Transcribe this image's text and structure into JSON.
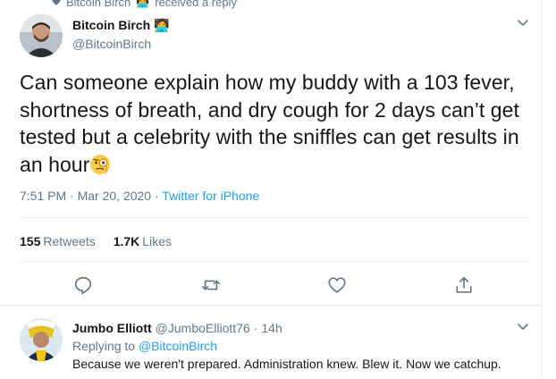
{
  "context": {
    "name": "Bitcoin Birch",
    "emoji": "🧑‍💻",
    "text": "received a reply"
  },
  "tweet": {
    "display_name": "Bitcoin Birch",
    "badge_emoji": "🧑‍💻",
    "handle": "@BitcoinBirch",
    "text": "Can someone explain how my buddy with a 103 fever, shortness of breath, and dry cough for 2 days can’t get tested but a celebrity with the sniffles can get results in an hour",
    "text_emoji": "face-with-monocle",
    "time": "7:51 PM",
    "sep": "·",
    "date": "Mar 20, 2020",
    "source": "Twitter for iPhone",
    "retweets_count": "155",
    "retweets_label": "Retweets",
    "likes_count": "1.7K",
    "likes_label": "Likes"
  },
  "actions": [
    {
      "icon": "reply-icon"
    },
    {
      "icon": "retweet-icon"
    },
    {
      "icon": "like-icon"
    },
    {
      "icon": "share-icon"
    }
  ],
  "reply": {
    "display_name": "Jumbo Elliott",
    "handle": "@JumboElliott76",
    "sep": "·",
    "time": "14h",
    "replying_to_label": "Replying to",
    "replying_to_handle": "@BitcoinBirch",
    "text": "Because we weren't prepared. Administration knew. Blew it. Now we catchup."
  },
  "colors": {
    "accent": "#1da1f2",
    "muted": "#657786",
    "text": "#14171a",
    "divider": "#e6ecf0"
  }
}
